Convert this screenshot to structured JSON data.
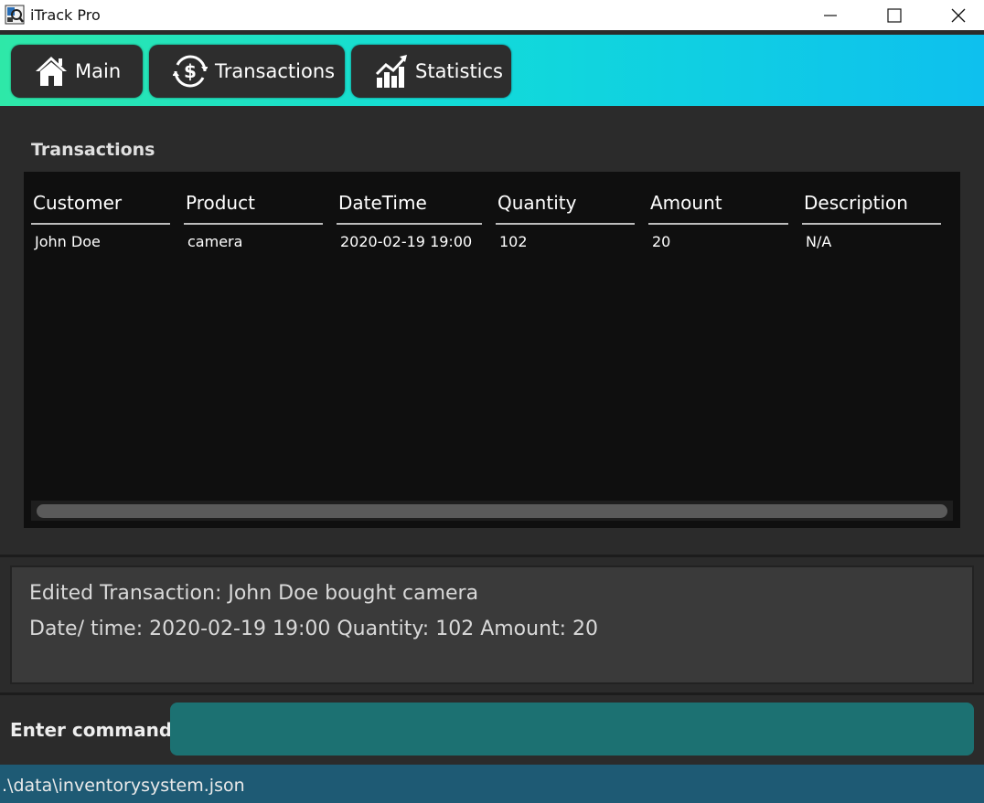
{
  "window": {
    "title": "iTrack Pro",
    "minimize_icon": "minimize-icon",
    "maximize_icon": "maximize-icon",
    "close_icon": "close-icon"
  },
  "tabs": [
    {
      "label": "Main",
      "icon": "home-icon"
    },
    {
      "label": "Transactions",
      "icon": "dollar-cycle-icon"
    },
    {
      "label": "Statistics",
      "icon": "chart-growth-icon"
    }
  ],
  "transactions": {
    "title": "Transactions",
    "columns": [
      "Customer",
      "Product",
      "DateTime",
      "Quantity",
      "Amount",
      "Description"
    ],
    "rows": [
      [
        "John Doe",
        "camera",
        "2020-02-19 19:00",
        "102",
        "20",
        "N/A"
      ]
    ]
  },
  "result": {
    "line1": "Edited Transaction: John Doe bought camera",
    "line2": "Date/ time: 2020-02-19 19:00 Quantity: 102 Amount: 20"
  },
  "command": {
    "label": "Enter command",
    "value": "",
    "placeholder": ""
  },
  "status": {
    "file_path": ".\\data\\inventorysystem.json"
  },
  "colors": {
    "tab_gradient_start": "#2ee8a8",
    "tab_gradient_end": "#0ec0ee",
    "command_input_bg": "#1c7172",
    "statusbar_bg": "#1e5a74"
  }
}
